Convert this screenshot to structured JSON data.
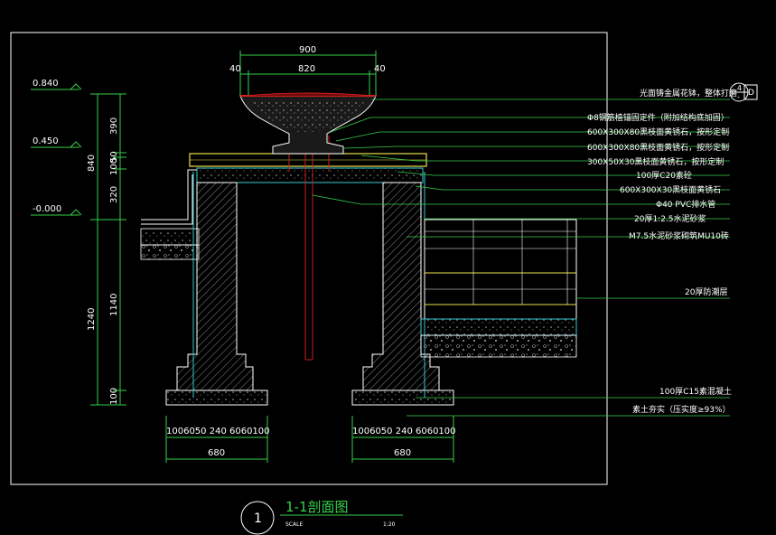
{
  "colors": {
    "background": "#000000",
    "dimension_line": "#36d14a",
    "structure": "#ffffff",
    "cyan_line": "#36c8d4",
    "yellow_line": "#e8e04a",
    "red_pipe": "#d02020",
    "leader": "#36d14a"
  },
  "dimensions_top": {
    "overall": "900",
    "left_offset": "40",
    "inner": "820",
    "right_offset": "40"
  },
  "elevations": [
    "0.840",
    "0.450",
    "-0.000"
  ],
  "dimensions_left": {
    "seg_390": "390",
    "seg_50": "50",
    "seg_100": "100",
    "seg_320": "320",
    "total_840": "840",
    "total_1240": "1240",
    "seg_1140": "1140",
    "seg_bottom_100": "100"
  },
  "dimensions_bottom_left": {
    "row": "1006050 240 6060100",
    "total": "680"
  },
  "dimensions_bottom_right": {
    "row": "1006050 240 6060100",
    "total": "680"
  },
  "annotations": [
    "光面铸金属花钵，整体打磨",
    "Φ8钢筋植锚固定件（附加结构底加固）",
    "600X300X80黑枝面黄锈石，按形定制",
    "600X300X80黑枝面黄锈石，按形定制",
    "300X50X30黑枝面黄锈石，按形定制",
    "100厚C20素砼",
    "600X300X30黑枝面黄锈石",
    "Φ40 PVC排水管",
    "20厚1:2.5水泥砂浆",
    "M7.5水泥砂浆砌筑MU10砖",
    "20厚防潮层",
    "100厚C15素混凝土",
    "素土夯实（压实度≥93%）"
  ],
  "detail_ref": {
    "top": "4",
    "bottom": "-",
    "side": "D"
  },
  "title_block": {
    "number": "1",
    "title": "1-1剖面图",
    "scale_label": "SCALE",
    "scale_value": "1:20"
  }
}
